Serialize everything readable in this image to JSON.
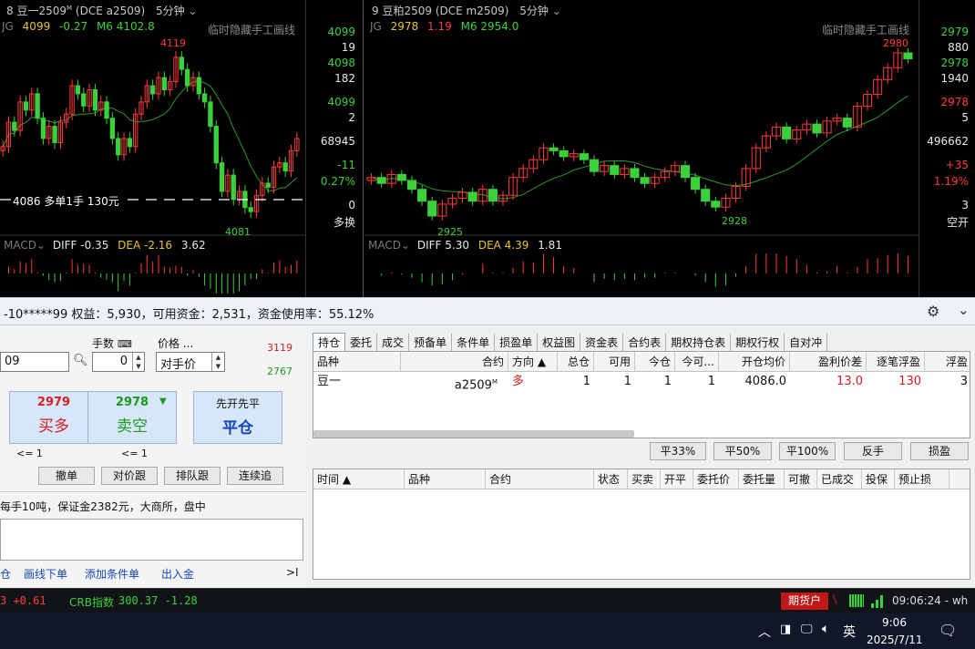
{
  "chart_left": {
    "pane_index": "8",
    "title": "豆一2509",
    "title_sup": "M",
    "exchange_contract": "(DCE a2509)",
    "period": "5分钟",
    "ind_name": "JG",
    "last": "4099",
    "change": "-0.27",
    "ma_label": "M6 4102.8",
    "hide_text": "临时隐藏手工画线",
    "high_label": "4119",
    "low_label": "4081",
    "order_line": "4086 多单1手 130元",
    "axis": [
      "4099",
      "19",
      "4098",
      "182",
      "4099",
      "2",
      "68945",
      "-11",
      "0.27%",
      "0",
      "多换"
    ],
    "macd_label": "MACD",
    "diff": "DIFF -0.35",
    "dea": "DEA -2.16",
    "macd_val": "3.62",
    "chart_data": {
      "type": "candlestick",
      "title": "",
      "series_close": [
        4097,
        4103,
        4101,
        4108,
        4106,
        4110,
        4104,
        4099,
        4102,
        4098,
        4103,
        4105,
        4112,
        4110,
        4107,
        4111,
        4106,
        4108,
        4104,
        4099,
        4095,
        4099,
        4097,
        4105,
        4108,
        4112,
        4110,
        4114,
        4111,
        4113,
        4119,
        4116,
        4112,
        4114,
        4110,
        4108,
        4102,
        4093,
        4086,
        4090,
        4084,
        4086,
        4082,
        4081,
        4085,
        4088,
        4087,
        4092,
        4093,
        4091,
        4096,
        4099
      ],
      "high": 4119,
      "low": 4081
    }
  },
  "chart_right": {
    "pane_index": "9",
    "title": "豆粕2509",
    "exchange_contract": "(DCE m2509)",
    "period": "5分钟",
    "ind_name": "JG",
    "last": "2978",
    "change": "1.19",
    "ma_label": "M6 2954.0",
    "hide_text": "临时隐藏手工画线",
    "high_label": "2980",
    "low_label_1": "2925",
    "low_label_2": "2928",
    "axis": [
      "2979",
      "880",
      "2978",
      "1940",
      "2978",
      "5",
      "496662",
      "+35",
      "1.19%",
      "3",
      "空开"
    ],
    "macd_label": "MACD",
    "diff": "DIFF 5.30",
    "dea": "DEA 4.39",
    "macd_val": "1.81",
    "chart_data": {
      "type": "candlestick",
      "title": "",
      "series_close": [
        2938,
        2936,
        2939,
        2937,
        2934,
        2930,
        2925,
        2929,
        2931,
        2933,
        2930,
        2934,
        2930,
        2932,
        2938,
        2941,
        2944,
        2948,
        2947,
        2945,
        2946,
        2944,
        2940,
        2942,
        2939,
        2941,
        2938,
        2936,
        2938,
        2940,
        2942,
        2938,
        2934,
        2930,
        2928,
        2931,
        2935,
        2941,
        2948,
        2952,
        2955,
        2951,
        2954,
        2956,
        2953,
        2957,
        2958,
        2955,
        2962,
        2966,
        2971,
        2975,
        2980,
        2978
      ],
      "high": 2980,
      "low": 2925
    }
  },
  "account": {
    "text": "-10*****99  权益：5,930，可用资金：2,531，资金使用率：55.12%"
  },
  "order_form": {
    "contract_value": "09",
    "qty_label": "手数",
    "qty_value": "0",
    "price_label": "价格 ...",
    "price_value": "对手价",
    "upper_limit": "3119",
    "lower_limit": "2767",
    "buy_price": "2979",
    "buy_label": "买多",
    "sell_price": "2978",
    "sell_label": "卖空",
    "close_top": "先开先平",
    "close_label": "平仓",
    "buy_hint": "<= 1",
    "sell_hint": "<= 1",
    "btn_cancel": "撤单",
    "btn_opp": "对价跟",
    "btn_queue": "排队跟",
    "btn_chase": "连续追",
    "info_line": "每手10吨，保证金2382元，大商所，盘中"
  },
  "bottom_links": [
    "仓",
    "画线下单",
    "添加条件单",
    "出入金",
    ">I"
  ],
  "tabs": [
    "持仓",
    "委托",
    "成交",
    "预备单",
    "条件单",
    "损盈单",
    "权益图",
    "资金表",
    "合约表",
    "期权持仓表",
    "期权行权",
    "自对冲"
  ],
  "positions": {
    "headers": [
      "品种",
      "合约",
      "方向 ▲",
      "总仓",
      "可用",
      "今仓",
      "今可...",
      "开仓均价",
      "盈利价差",
      "逐笔浮盈",
      "浮盈"
    ],
    "rows": [
      {
        "variety": "豆一",
        "contract": "a2509",
        "contract_sup": "M",
        "direction": "多",
        "total": "1",
        "avail": "1",
        "today": "1",
        "today_avail": "1",
        "avg_price": "4086.0",
        "profit_diff": "13.0",
        "float_pnl": "130",
        "float2": "3"
      }
    ]
  },
  "pos_buttons": [
    "平33%",
    "平50%",
    "平100%",
    "反手",
    "损盈"
  ],
  "orders": {
    "headers": [
      "时间 ▲",
      "品种",
      "合约",
      "状态",
      "买卖",
      "开平",
      "委托价",
      "委托量",
      "可撤",
      "已成交",
      "投保",
      "预止损"
    ]
  },
  "status_bar": {
    "quote1": "3 +0.61",
    "crb_label": "CRB指数",
    "crb_value": "300.37 -1.28",
    "account_type": "期货户",
    "time": "09:06:24 - wh"
  },
  "taskbar": {
    "ime": "英",
    "time": "9:06",
    "date": "2025/7/11"
  },
  "colors": {
    "up": "#ff3b3b",
    "down": "#3ad13a",
    "ma": "#2a9a2a",
    "panel_bg": "#f0f0f0",
    "buy_text": "#d42020",
    "sell_text": "#1a9a1a",
    "close_text": "#1446b8"
  }
}
